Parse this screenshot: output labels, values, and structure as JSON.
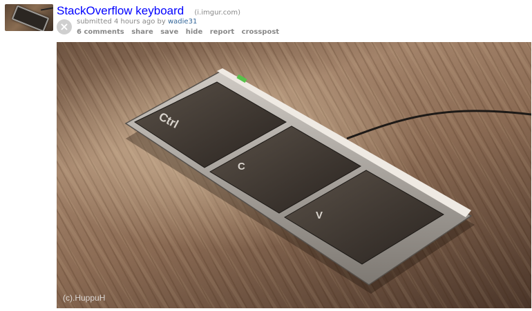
{
  "post": {
    "title": "StackOverflow keyboard",
    "domain": "(i.imgur.com)",
    "submitted_prefix": "submitted ",
    "time_ago": "4 hours ago",
    "by_text": " by ",
    "author": "wadie31",
    "hide_glyph": "×"
  },
  "buttons": {
    "comments": "6 comments",
    "share": "share",
    "save": "save",
    "hide": "hide",
    "report": "report",
    "crosspost": "crosspost"
  },
  "media": {
    "keys": [
      "Ctrl",
      "C",
      "V"
    ],
    "credit": "(c).HuppuH"
  },
  "colors": {
    "title_link": "#0000ff",
    "author_link": "#336699",
    "meta_text": "#888888"
  }
}
